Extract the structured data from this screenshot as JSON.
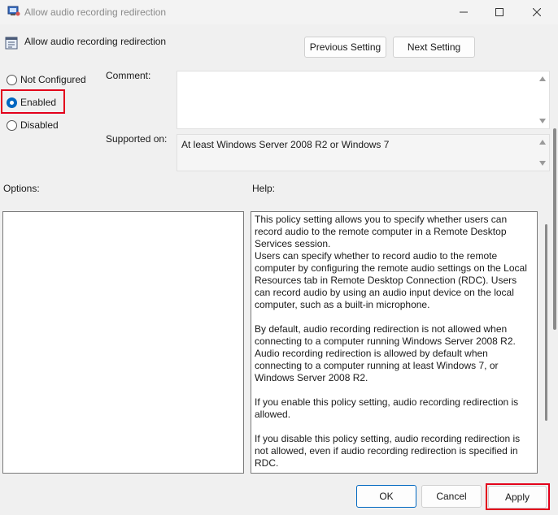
{
  "window": {
    "title": "Allow audio recording redirection"
  },
  "header": {
    "policy_name": "Allow audio recording redirection",
    "previous_label": "Previous Setting",
    "next_label": "Next Setting"
  },
  "state": {
    "options": [
      {
        "label": "Not Configured",
        "selected": false
      },
      {
        "label": "Enabled",
        "selected": true
      },
      {
        "label": "Disabled",
        "selected": false
      }
    ]
  },
  "fields": {
    "comment_label": "Comment:",
    "comment_value": "",
    "supported_label": "Supported on:",
    "supported_value": "At least Windows Server 2008 R2 or Windows 7"
  },
  "panes": {
    "options_label": "Options:",
    "help_label": "Help:",
    "help_paragraphs": [
      "This policy setting allows you to specify whether users can record audio to the remote computer in a Remote Desktop Services session.",
      "Users can specify whether to record audio to the remote computer by configuring the remote audio settings on the Local Resources tab in Remote Desktop Connection (RDC). Users can record audio by using an audio input device on the local computer, such as a built-in microphone.",
      "By default, audio recording redirection is not allowed when connecting to a computer running Windows Server 2008 R2. Audio recording redirection is allowed by default when connecting to a computer running at least Windows 7, or Windows Server 2008 R2.",
      "If you enable this policy setting, audio recording redirection is allowed.",
      "If you disable this policy setting, audio recording redirection is not allowed, even if audio recording redirection is specified in RDC."
    ]
  },
  "footer": {
    "ok_label": "OK",
    "cancel_label": "Cancel",
    "apply_label": "Apply"
  },
  "colors": {
    "accent": "#0067c0",
    "highlight": "#e3001b"
  }
}
